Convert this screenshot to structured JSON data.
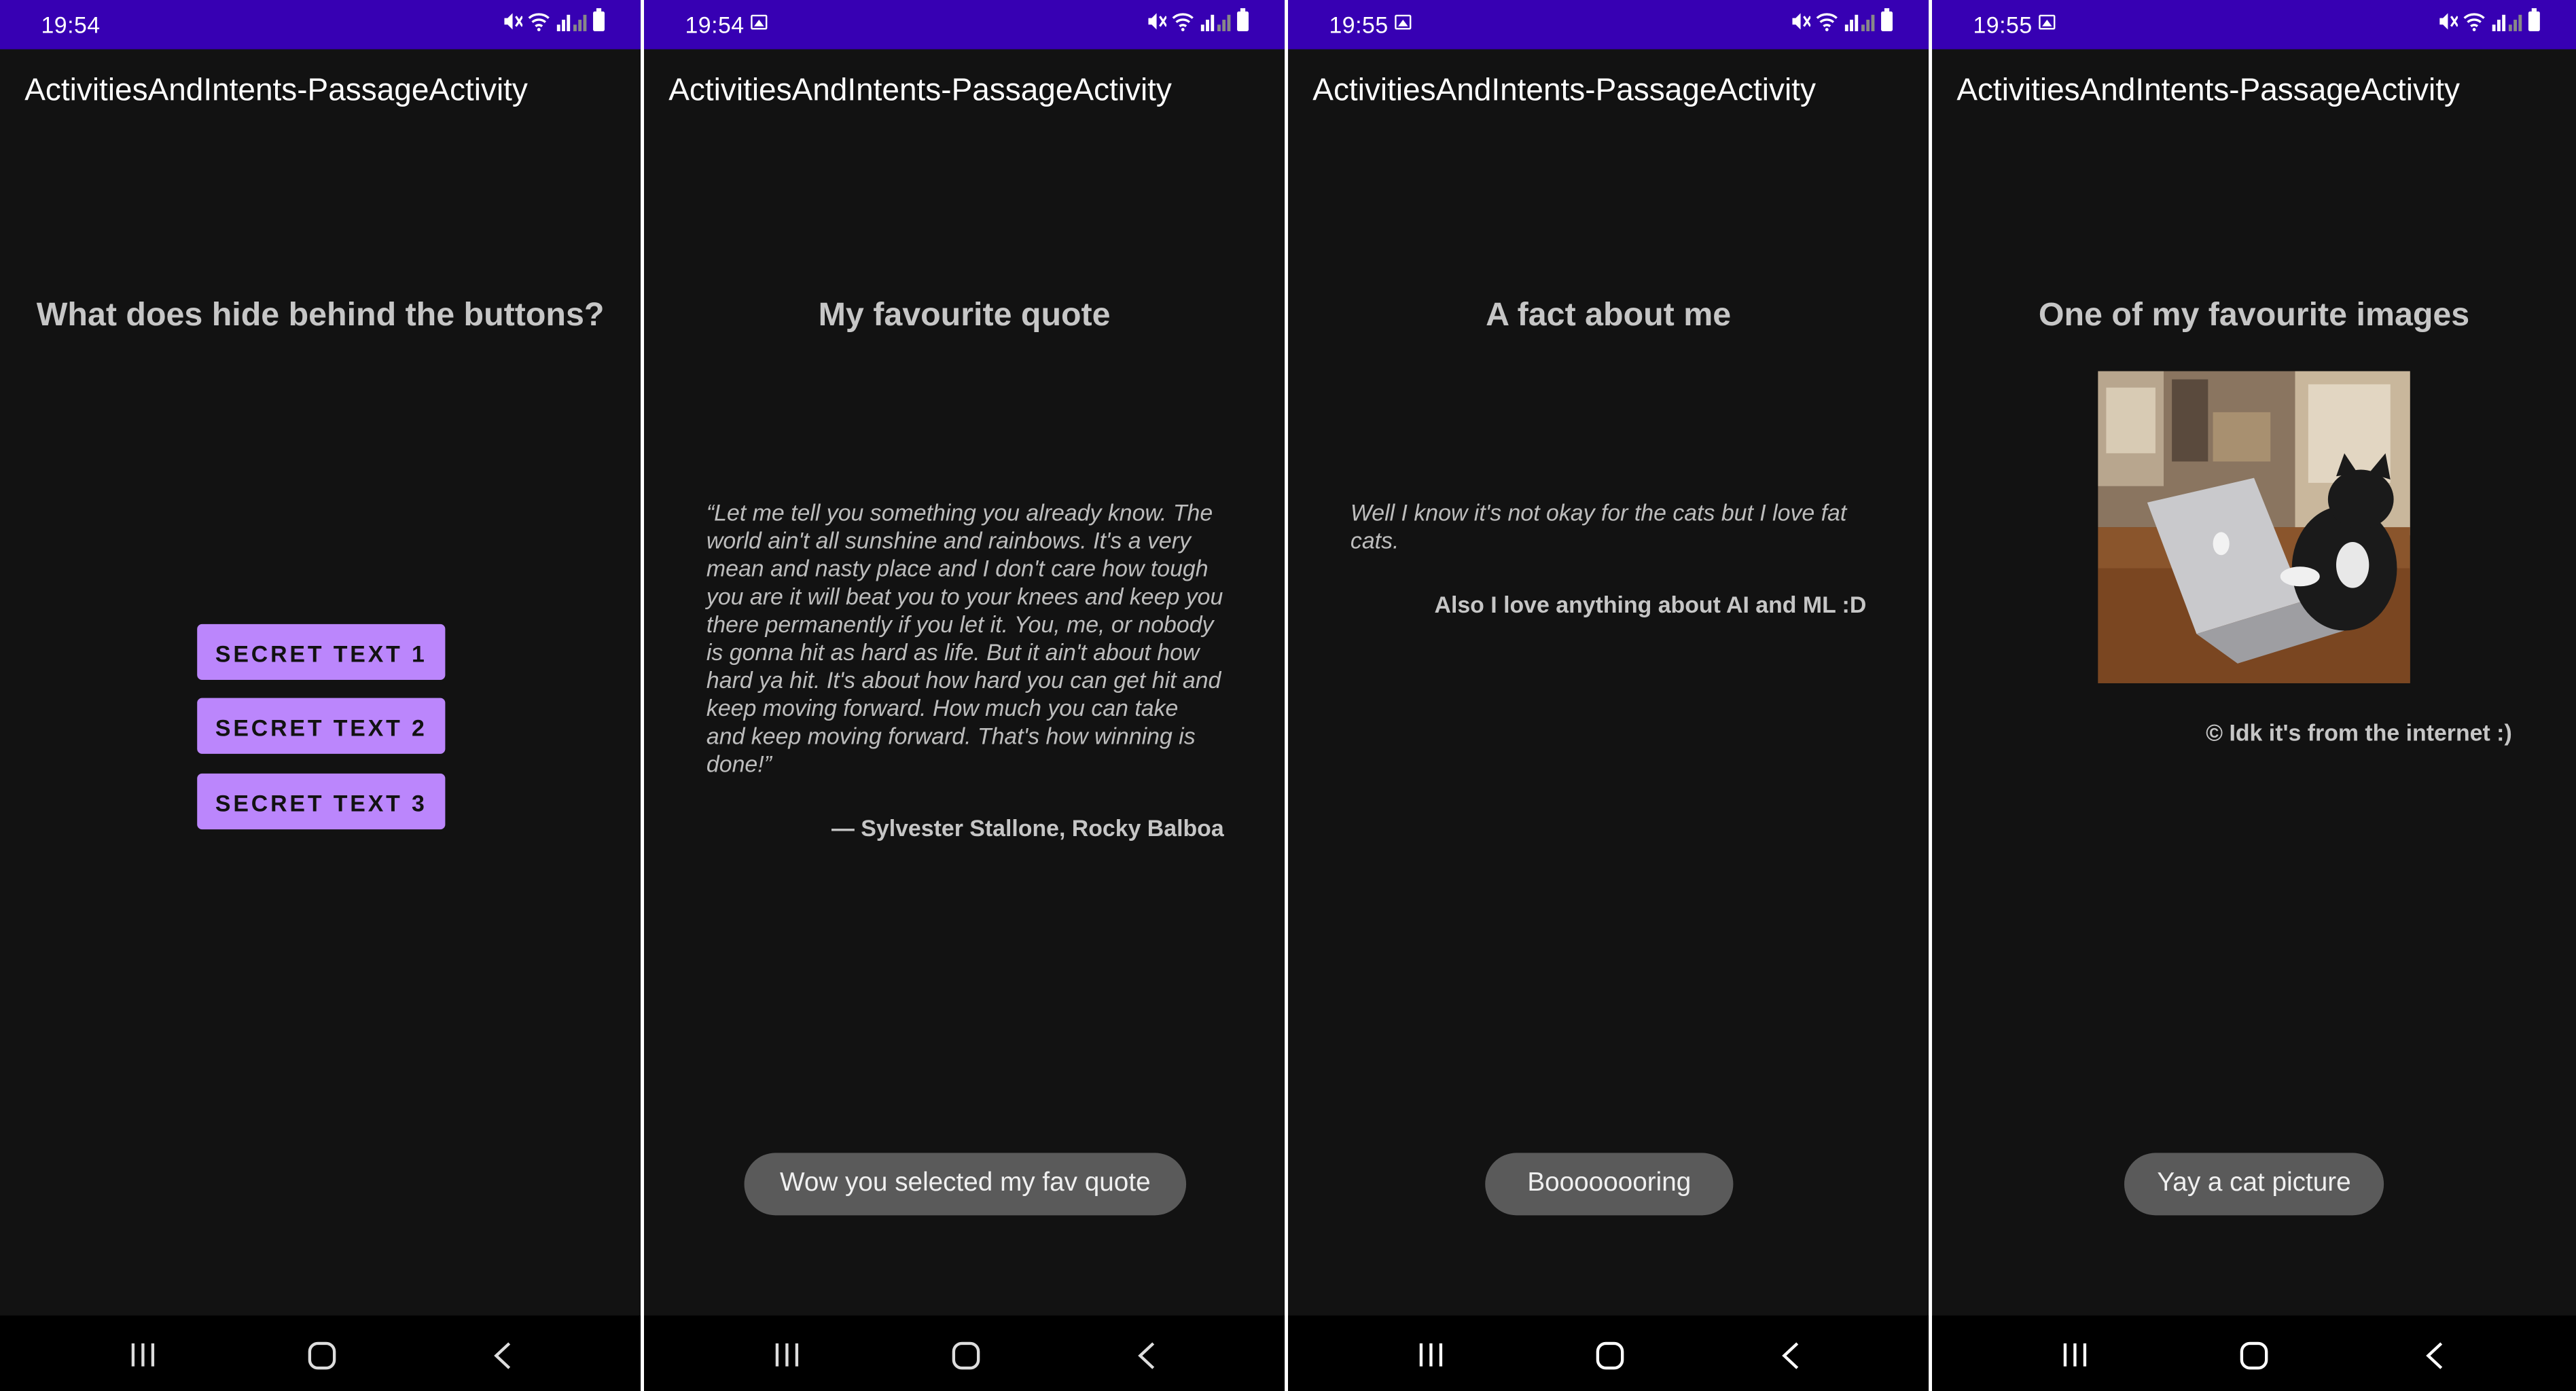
{
  "screens": [
    {
      "time": "19:54",
      "app_title": "ActivitiesAndIntents-PassageActivity",
      "heading": "What does hide behind the buttons?",
      "buttons": [
        "SECRET TEXT 1",
        "SECRET TEXT 2",
        "SECRET TEXT 3"
      ]
    },
    {
      "time": "19:54",
      "app_title": "ActivitiesAndIntents-PassageActivity",
      "heading": "My favourite quote",
      "quote_lines": [
        "“Let me tell you something you already know. The",
        "world ain't all sunshine and rainbows. It's a very",
        "mean and nasty place and I don't care how tough",
        "you are it will beat you to your knees and keep you",
        "there permanently if you let it. You, me, or nobody",
        "is gonna hit as hard as life. But it ain't about how",
        "hard ya hit. It's about how hard you can get hit and",
        "keep moving forward. How much you can take",
        "and keep moving forward. That's how winning is",
        "done!”"
      ],
      "attribution": "— Sylvester Stallone, Rocky Balboa",
      "toast": "Wow you selected my fav quote"
    },
    {
      "time": "19:55",
      "app_title": "ActivitiesAndIntents-PassageActivity",
      "heading": "A fact about me",
      "fact_lines": [
        "Well I know it's not okay for the cats but I love fat",
        "cats."
      ],
      "fact_extra": "Also I love anything about AI and ML :D",
      "toast": "Boooooooring"
    },
    {
      "time": "19:55",
      "app_title": "ActivitiesAndIntents-PassageActivity",
      "heading": "One of my favourite images",
      "caption": "© Idk it's from the internet :)",
      "toast": "Yay a cat picture"
    }
  ],
  "colors": {
    "status_bar": "#3700b3",
    "background": "#121212",
    "button": "#bb86fc",
    "toast": "#5a5a5a",
    "nav_bar": "#000000"
  },
  "icons": {
    "status": [
      "gallery-icon",
      "mute-icon",
      "wifi-icon",
      "signal-icon",
      "battery-icon"
    ],
    "navigation": [
      "recents-icon",
      "home-icon",
      "back-icon"
    ]
  }
}
